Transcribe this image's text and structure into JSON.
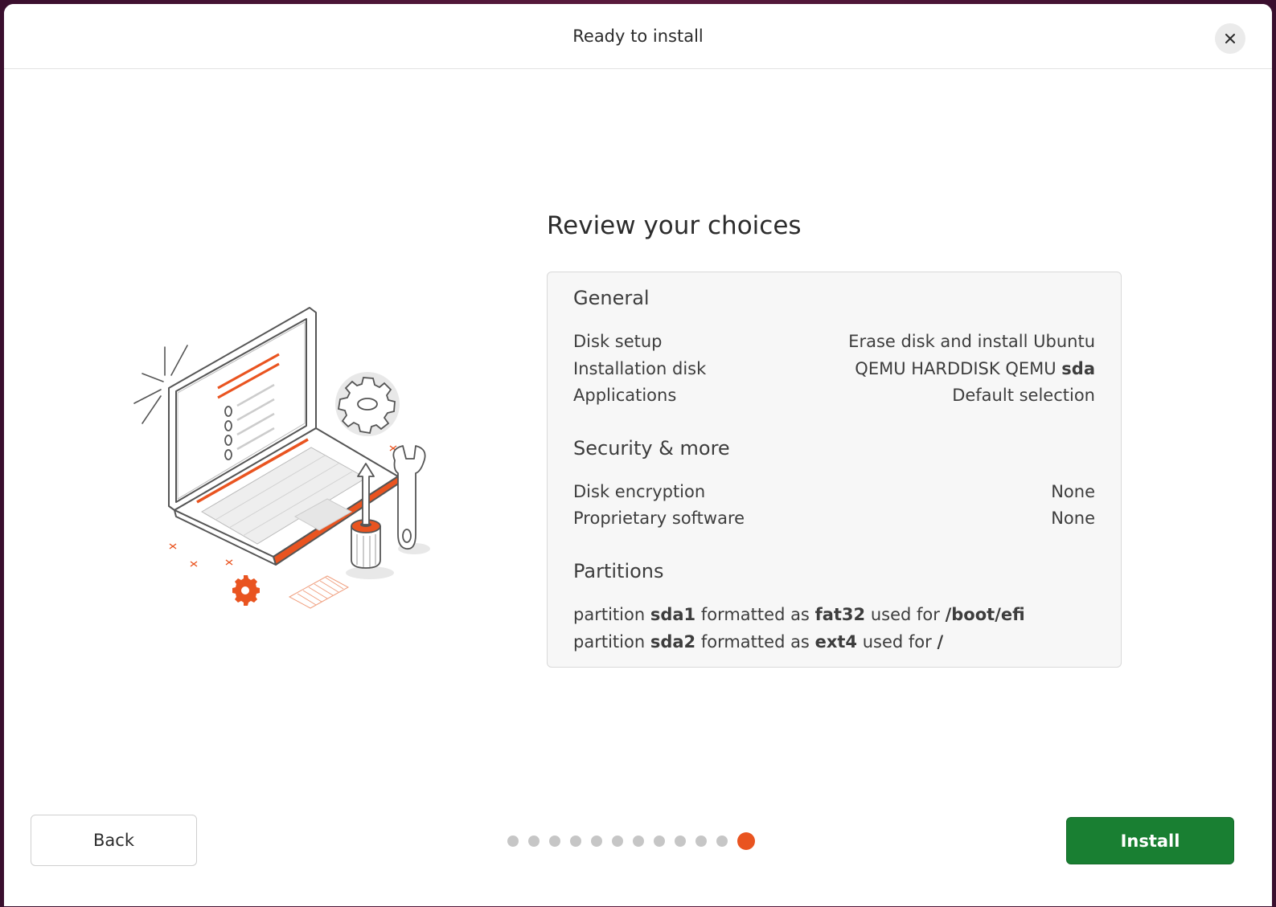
{
  "window": {
    "title": "Ready to install"
  },
  "icons": {
    "close": "close-icon",
    "illustration": "laptop-tools-illustration"
  },
  "main": {
    "heading": "Review your choices"
  },
  "general": {
    "title": "General",
    "rows": [
      {
        "label": "Disk setup",
        "value": "Erase disk and install Ubuntu"
      },
      {
        "label": "Installation disk",
        "value": "QEMU HARDDISK QEMU",
        "value_bold": "sda"
      },
      {
        "label": "Applications",
        "value": "Default selection"
      }
    ]
  },
  "security": {
    "title": "Security & more",
    "rows": [
      {
        "label": "Disk encryption",
        "value": "None"
      },
      {
        "label": "Proprietary software",
        "value": "None"
      }
    ]
  },
  "partitions": {
    "title": "Partitions",
    "items": [
      {
        "w1": "partition",
        "name": "sda1",
        "w2": "formatted as",
        "fs": "fat32",
        "w3": "used for",
        "mount": "/boot/efi"
      },
      {
        "w1": "partition",
        "name": "sda2",
        "w2": "formatted as",
        "fs": "ext4",
        "w3": "used for",
        "mount": "/"
      }
    ]
  },
  "footer": {
    "back_label": "Back",
    "install_label": "Install",
    "progress": {
      "total_steps": 12,
      "current_step": 12
    }
  },
  "colors": {
    "accent": "#e95420",
    "install_button": "#197f32",
    "dot_inactive": "#c6c6c6"
  }
}
